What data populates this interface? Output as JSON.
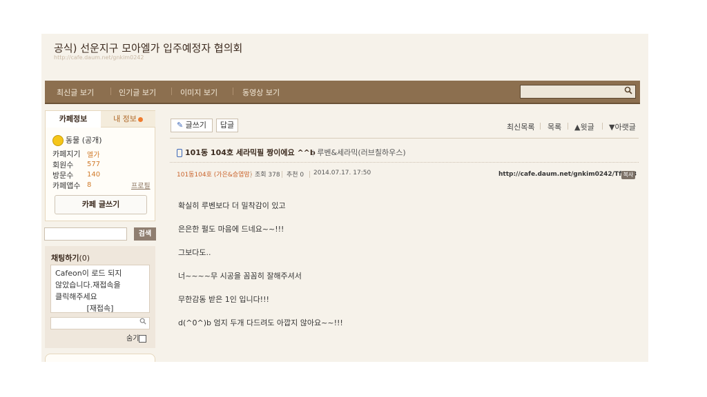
{
  "cafe": {
    "title": "공식) 선운지구 모아엘가 입주예정자 협의회",
    "url": "http://cafe.daum.net/gnkim0242"
  },
  "nav": {
    "items": [
      "최신글 보기",
      "인기글 보기",
      "이미지 보기",
      "동영상 보기"
    ],
    "search_icon": "search-icon"
  },
  "sidebar": {
    "tab_info": "카페정보",
    "tab_my": "내 정보",
    "grade": "동물 (공개)",
    "info": [
      {
        "label": "카페지기",
        "value": "엘가"
      },
      {
        "label": "회원수",
        "value": "577"
      },
      {
        "label": "방문수",
        "value": "140"
      },
      {
        "label": "카페앱수",
        "value": "8"
      }
    ],
    "profile_link": "프로필",
    "write_button": "카페 글쓰기",
    "search_button": "검색",
    "chat": {
      "title": "채팅하기",
      "count": "(0)",
      "message_lines": [
        "Cafeon이 로드 되지",
        "않았습니다.재접속을",
        "클릭해주세요"
      ],
      "reconnect": "[재접속]",
      "hide_label": "숨기"
    }
  },
  "toolbar": {
    "write": "글쓰기",
    "reply": "답글",
    "links": [
      "최신목록",
      "목록",
      "▲윗글",
      "▼아랫글"
    ]
  },
  "post": {
    "title": "101동 104호 세라믹필 짱이에요 ^^b",
    "category": "루벤&세라믹(러브칠하우스)",
    "author": "101동104호 (가은&승엽맘)",
    "views": "조회 378",
    "recommends": "추천 0",
    "date": "2014.07.17. 17:50",
    "url": "http://cafe.daum.net/gnkim0242/TfTg/3",
    "copy_label": "복사",
    "body": [
      "확실히 루벤보다 더 밀착감이 있고",
      "은은한 펄도 마음에 드네요~~!!!",
      "그보다도..",
      "너~~~~무 시공을 꼼꼼히 잘해주셔서",
      "무한감동 받은 1인 입니다!!!",
      "d(^0^)b 엄지 두개 다드려도 아깝지 않아요~~!!!"
    ]
  },
  "colors": {
    "nav_bg": "#8c6f4f",
    "page_bg": "#f6f2ea",
    "accent_orange": "#d07a2a"
  }
}
